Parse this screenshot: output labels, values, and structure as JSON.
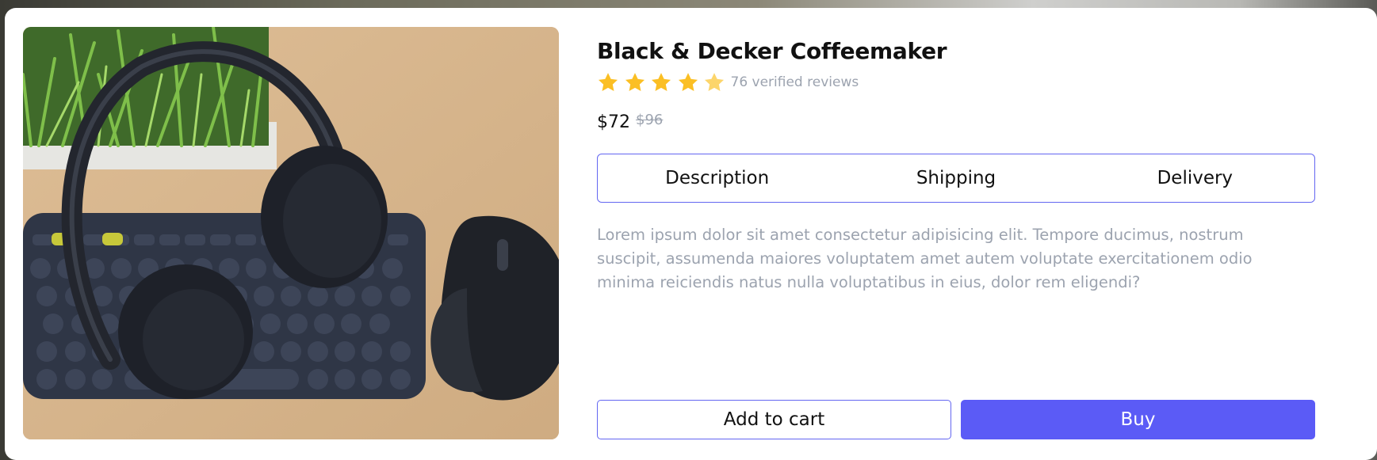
{
  "product": {
    "title": "Black & Decker Coffeemaker",
    "rating": {
      "stars_filled": 4,
      "stars_total": 5,
      "reviews_text": "76 verified reviews",
      "star_color": "#fbbf24",
      "star_partial_color": "#fcd56b"
    },
    "price": {
      "current": "$72",
      "original": "$96"
    },
    "image_alt": "headphones-keyboard-mouse-photo"
  },
  "tabs": [
    {
      "label": "Description"
    },
    {
      "label": "Shipping"
    },
    {
      "label": "Delivery"
    }
  ],
  "description": "Lorem ipsum dolor sit amet consectetur adipisicing elit. Tempore ducimus, nostrum suscipit, assumenda maiores voluptatem amet autem voluptate exercitationem odio minima reiciendis natus nulla voluptatibus in eius, dolor rem eligendi?",
  "actions": {
    "add_to_cart": "Add to cart",
    "buy": "Buy"
  },
  "colors": {
    "accent": "#5b5bf6",
    "border": "#6366f1",
    "muted_text": "#9ca3af"
  }
}
